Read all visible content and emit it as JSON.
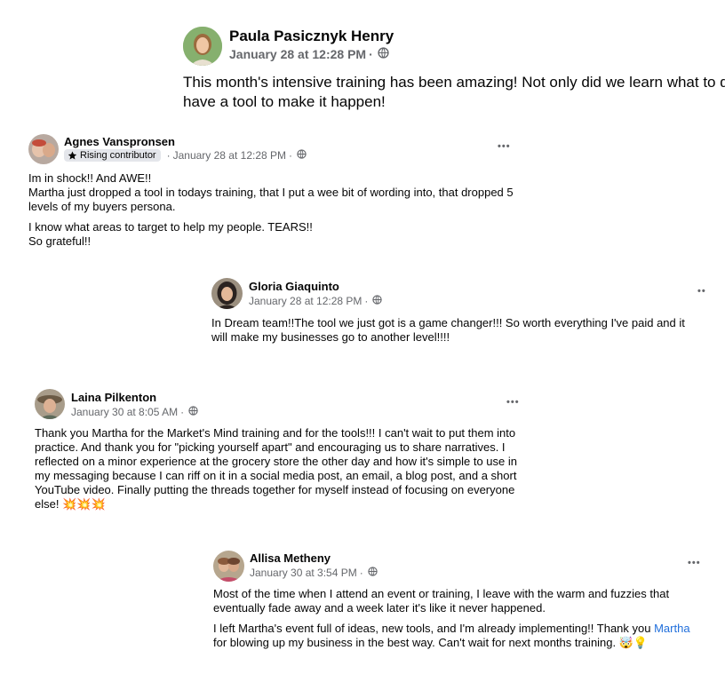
{
  "posts": [
    {
      "author": "Paula Pasicznyk Henry",
      "time": "January 28 at 12:28 PM",
      "text": [
        "This month's intensive training has been amazing! Not only did we learn what to d",
        "have a tool to make it happen!"
      ]
    },
    {
      "author": "Agnes Vanspronsen",
      "badge": "Rising contributor",
      "time": "January 28 at 12:28 PM",
      "more": "•••",
      "text": [
        "Im in shock!!  And AWE!!",
        "Martha just dropped a tool in todays training, that I put a wee bit of wording into, that dropped 5",
        "levels of my buyers persona.",
        "I know what areas to target to help my people. TEARS!!",
        "So grateful!!"
      ]
    },
    {
      "author": "Gloria Giaquinto",
      "time": "January 28 at 12:28 PM",
      "more": "••",
      "text": [
        "In Dream team!!The tool we just got is a game changer!!! So worth everything I've paid and it",
        "will make my businesses go to another level!!!!"
      ]
    },
    {
      "author": "Laina Pilkenton",
      "time": "January 30 at 8:05 AM",
      "more": "•••",
      "text": [
        "Thank you Martha for the Market's Mind training and for the tools!!! I can't wait to put them into",
        "practice. And thank you for \"picking yourself apart\" and encouraging us to share narratives. I",
        "reflected on a minor experience at the grocery store the other day and how it's simple to use in",
        "my messaging because I can riff on it in a social media post, an email, a blog post, and a short",
        "YouTube video. Finally putting the threads together for myself instead of focusing on everyone",
        "else! 💥💥💥"
      ]
    },
    {
      "author": "Allisa Metheny",
      "time": "January 30 at 3:54 PM",
      "more": "•••",
      "text": [
        "Most of the time when I attend an event or training, I leave with the warm and fuzzies that",
        "eventually fade away and a week later it's like it never happened.",
        "I left Martha's event full of ideas, new tools, and I'm already implementing!! Thank you ",
        "Martha",
        "for blowing up my business in the best way. Can't wait for next months training. 🤯💡"
      ]
    }
  ],
  "separator": "·",
  "icons": {
    "audience": "globe-icon",
    "badge": "star-icon",
    "menu": "more-options-icon"
  },
  "colors": {
    "meta": "#65676b",
    "mention": "#216fdb",
    "badge_bg": "#e4e6eb"
  }
}
